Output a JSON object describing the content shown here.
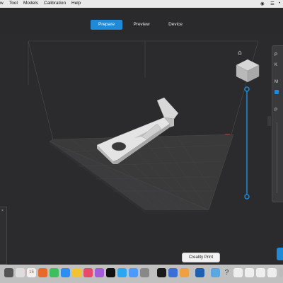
{
  "menubar": {
    "items": [
      "w",
      "Tool",
      "Models",
      "Calibration",
      "Help"
    ]
  },
  "tabs": [
    {
      "label": "Prepare",
      "active": true
    },
    {
      "label": "Preview",
      "active": false
    },
    {
      "label": "Device",
      "active": false
    }
  ],
  "right_panel": {
    "row1": "P",
    "row2": "K",
    "row3": "M",
    "row4": "P"
  },
  "tooltip": {
    "text": "Creality Print"
  },
  "dock": {
    "badge": "15"
  },
  "colors": {
    "accent": "#1f8ad8",
    "background": "#2b2b2d",
    "bed": "#3a3a3a"
  }
}
